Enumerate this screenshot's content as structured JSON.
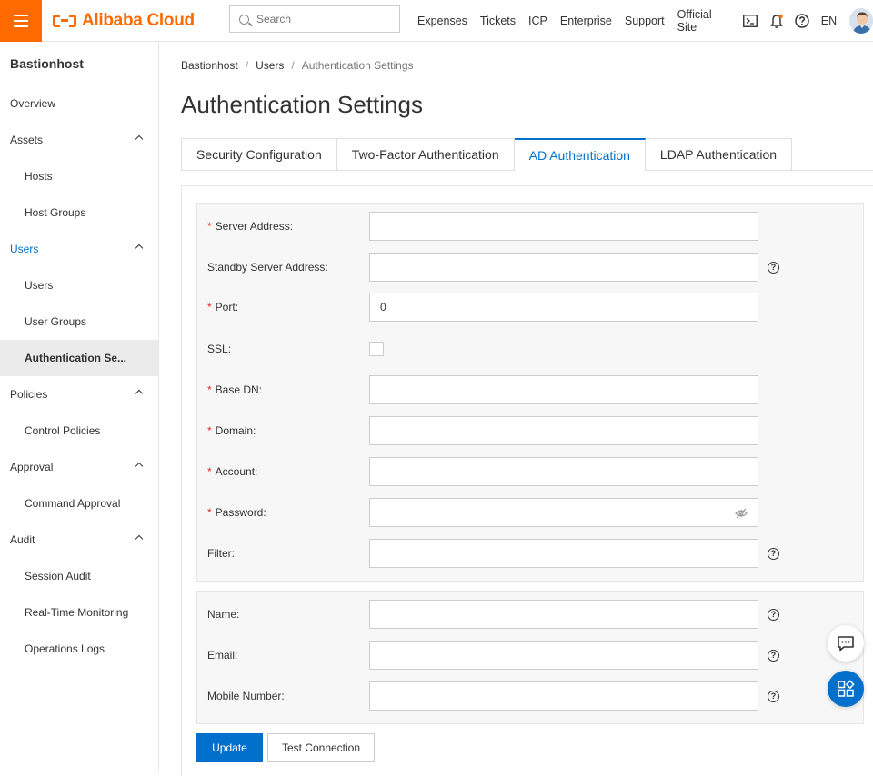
{
  "brand": {
    "logo_text": "Alibaba Cloud",
    "accent": "#ff6a00",
    "primary": "#0070cc"
  },
  "search": {
    "placeholder": "Search"
  },
  "topnav": {
    "links": [
      "Expenses",
      "Tickets",
      "ICP",
      "Enterprise",
      "Support",
      "Official Site"
    ],
    "language": "EN"
  },
  "sidebar": {
    "title": "Bastionhost",
    "items": [
      {
        "label": "Overview"
      },
      {
        "label": "Assets"
      },
      {
        "label": "Hosts"
      },
      {
        "label": "Host Groups"
      },
      {
        "label": "Users"
      },
      {
        "label": "Users"
      },
      {
        "label": "User Groups"
      },
      {
        "label": "Authentication Se..."
      },
      {
        "label": "Policies"
      },
      {
        "label": "Control Policies"
      },
      {
        "label": "Approval"
      },
      {
        "label": "Command Approval"
      },
      {
        "label": "Audit"
      },
      {
        "label": "Session Audit"
      },
      {
        "label": "Real-Time Monitoring"
      },
      {
        "label": "Operations Logs"
      }
    ]
  },
  "breadcrumb": [
    "Bastionhost",
    "Users",
    "Authentication Settings"
  ],
  "page": {
    "title": "Authentication Settings"
  },
  "tabs": [
    {
      "label": "Security Configuration"
    },
    {
      "label": "Two-Factor Authentication"
    },
    {
      "label": "AD Authentication"
    },
    {
      "label": "LDAP Authentication"
    }
  ],
  "form": {
    "server_address": {
      "label": "Server Address",
      "value": ""
    },
    "standby_server_address": {
      "label": "Standby Server Address",
      "value": ""
    },
    "port": {
      "label": "Port",
      "value": "0"
    },
    "ssl": {
      "label": "SSL",
      "checked": false
    },
    "base_dn": {
      "label": "Base DN",
      "value": ""
    },
    "domain": {
      "label": "Domain",
      "value": ""
    },
    "account": {
      "label": "Account",
      "value": ""
    },
    "password": {
      "label": "Password",
      "value": ""
    },
    "filter": {
      "label": "Filter",
      "value": ""
    },
    "name": {
      "label": "Name",
      "value": ""
    },
    "email": {
      "label": "Email",
      "value": ""
    },
    "mobile_number": {
      "label": "Mobile Number",
      "value": ""
    },
    "colon": ":",
    "required_mark": "*",
    "help_mark": "?"
  },
  "buttons": {
    "update": "Update",
    "test_connection": "Test Connection"
  }
}
